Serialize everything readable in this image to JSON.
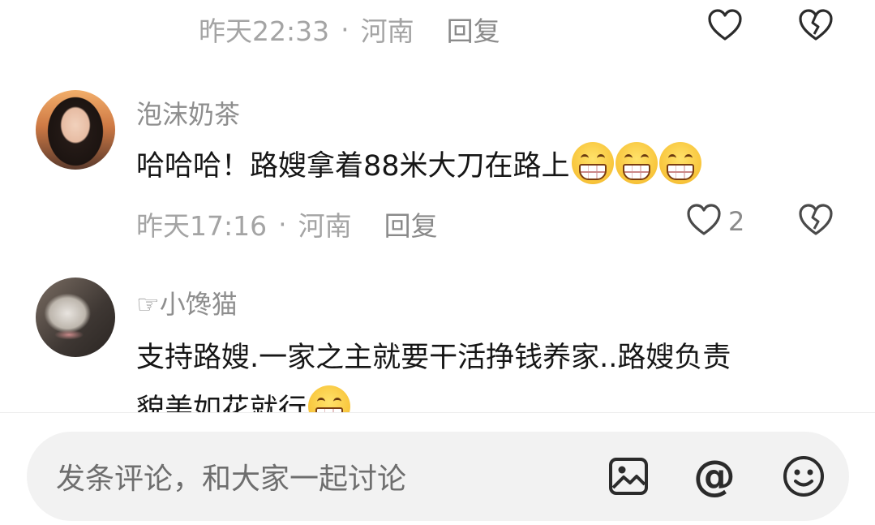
{
  "comments": [
    {
      "meta": {
        "time": "昨天22:33",
        "separator": "·",
        "location": "河南",
        "reply": "回复"
      },
      "like_icon": "heart-outline-icon",
      "dislike_icon": "broken-heart-icon"
    },
    {
      "username": "泡沫奶茶",
      "text": "哈哈哈！路嫂拿着88米大刀在路上",
      "emojis": [
        "grin-emoji",
        "grin-emoji",
        "grin-emoji"
      ],
      "meta": {
        "time": "昨天17:16",
        "separator": "·",
        "location": "河南",
        "reply": "回复"
      },
      "like_count": "2",
      "like_icon": "heart-outline-icon",
      "dislike_icon": "broken-heart-icon"
    },
    {
      "username": "☞小馋猫",
      "line1": "支持路嫂.一家之主就要干活挣钱养家..路嫂负责",
      "line2": "貌美如花就行",
      "emojis": [
        "blush-emoji"
      ]
    }
  ],
  "input": {
    "placeholder": "发条评论，和大家一起讨论",
    "icons": [
      "image-icon",
      "at-icon",
      "emoji-icon"
    ]
  },
  "colors": {
    "meta_text": "#a4a4a4",
    "input_bg": "#f2f2f2",
    "icon": "#2b2b2b"
  }
}
